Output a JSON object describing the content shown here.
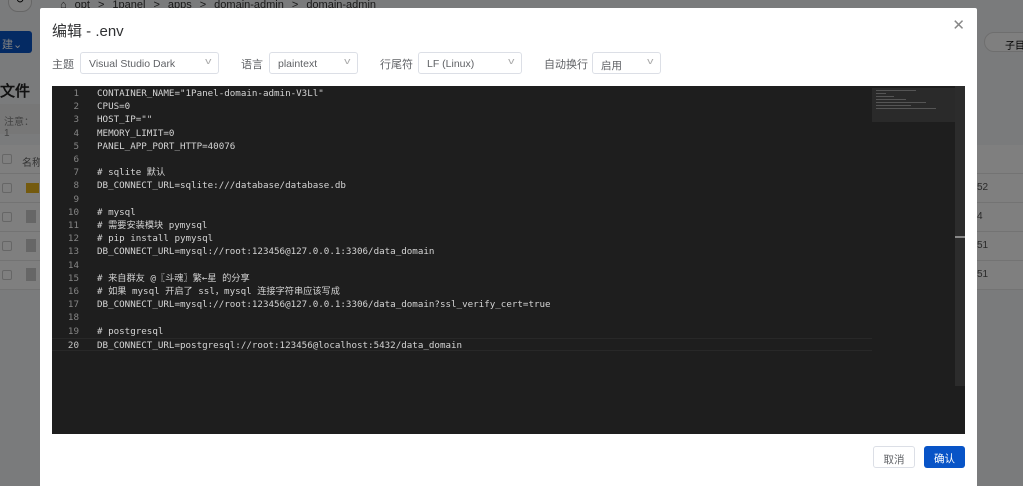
{
  "background": {
    "breadcrumb": [
      "opt",
      "1panel",
      "apps",
      "domain-admin",
      "domain-admin"
    ],
    "new_button": "建",
    "page_title": "文件",
    "note": "注意：1",
    "header_name": "名称",
    "sub_toggle": "子目",
    "row_tails": [
      "52",
      "4",
      "51",
      "51"
    ]
  },
  "dialog": {
    "title": "编辑 - .env",
    "theme_label": "主题",
    "theme_value": "Visual Studio Dark",
    "language_label": "语言",
    "language_value": "plaintext",
    "eol_label": "行尾符",
    "eol_value": "LF (Linux)",
    "wrap_label": "自动换行",
    "wrap_value": "启用",
    "cancel": "取消",
    "confirm": "确认"
  },
  "editor": {
    "current_line": 20,
    "lines": [
      "CONTAINER_NAME=\"1Panel-domain-admin-V3Ll\"",
      "CPUS=0",
      "HOST_IP=\"\"",
      "MEMORY_LIMIT=0",
      "PANEL_APP_PORT_HTTP=40076",
      "",
      "# sqlite 默认",
      "DB_CONNECT_URL=sqlite:///database/database.db",
      "",
      "# mysql",
      "# 需要安装模块 pymysql",
      "# pip install pymysql",
      "DB_CONNECT_URL=mysql://root:123456@127.0.0.1:3306/data_domain",
      "",
      "# 来自群友 @〖斗魂〗繁←星 的分享",
      "# 如果 mysql 开启了 ssl，mysql 连接字符串应该写成",
      "DB_CONNECT_URL=mysql://root:123456@127.0.0.1:3306/data_domain?ssl_verify_cert=true",
      "",
      "# postgresql",
      "DB_CONNECT_URL=postgresql://root:123456@localhost:5432/data_domain"
    ]
  }
}
